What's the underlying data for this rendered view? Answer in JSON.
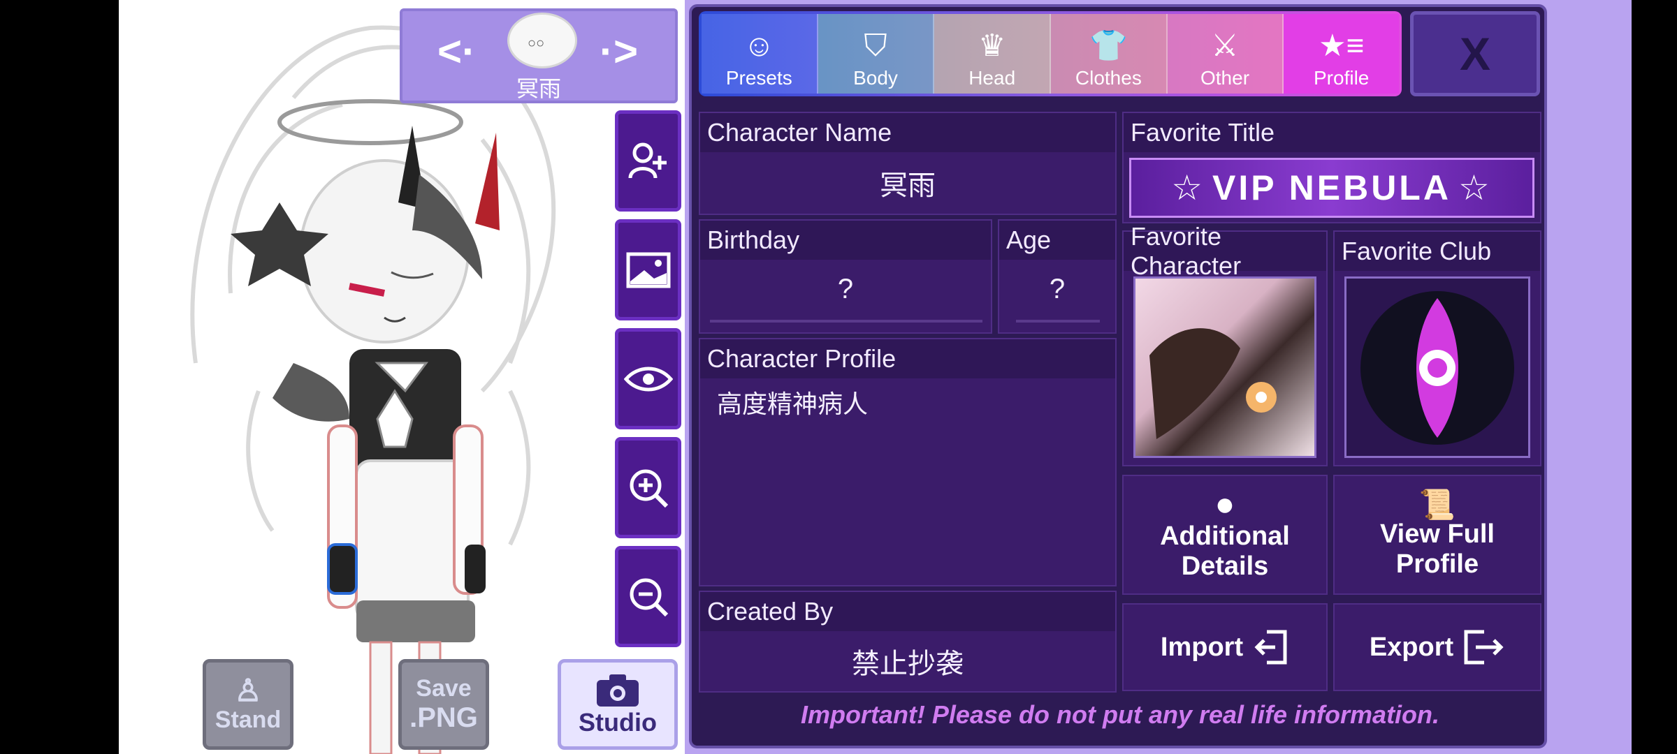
{
  "character": {
    "name": "冥雨"
  },
  "left_controls": {
    "prev_label": "<·",
    "next_label": "·>",
    "side_buttons": [
      "add-user",
      "background",
      "visibility",
      "zoom-in",
      "zoom-out"
    ],
    "stand_label": "Stand",
    "save_label_line1": "Save",
    "save_label_line2": ".PNG",
    "studio_label": "Studio"
  },
  "tabs": [
    {
      "label": "Presets",
      "icon": "person-icon"
    },
    {
      "label": "Body",
      "icon": "shirt-icon"
    },
    {
      "label": "Head",
      "icon": "hair-icon"
    },
    {
      "label": "Clothes",
      "icon": "tshirt-icon"
    },
    {
      "label": "Other",
      "icon": "sword-cat-icon"
    },
    {
      "label": "Profile",
      "icon": "star-list-icon"
    }
  ],
  "close_label": "X",
  "profile": {
    "character_name_label": "Character Name",
    "character_name_value": "冥雨",
    "favorite_title_label": "Favorite Title",
    "favorite_title_value": "VIP NEBULA",
    "birthday_label": "Birthday",
    "birthday_value": "?",
    "age_label": "Age",
    "age_value": "?",
    "favorite_character_label": "Favorite Character",
    "favorite_club_label": "Favorite Club",
    "character_profile_label": "Character Profile",
    "character_profile_value": "高度精神病人",
    "created_by_label": "Created By",
    "created_by_value": "禁止抄袭",
    "additional_details_line1": "Additional",
    "additional_details_line2": "Details",
    "view_full_profile_line1": "View Full",
    "view_full_profile_line2": "Profile",
    "import_label": "Import",
    "export_label": "Export",
    "footer_note": "Important! Please do not put any real life information."
  },
  "colors": {
    "panel_bg": "#2d1a54",
    "tab_gradient_start": "#2c4bd8",
    "tab_gradient_end": "#e04be0",
    "accent": "#d07cf0"
  }
}
